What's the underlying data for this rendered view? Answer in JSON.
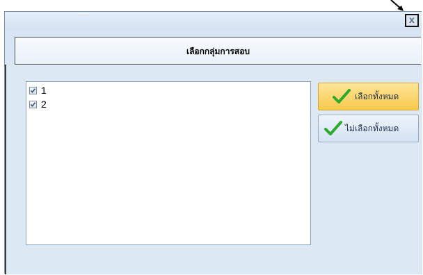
{
  "window": {
    "close_glyph": "x"
  },
  "header": {
    "title": "เลือกกลุ่มการสอบ"
  },
  "list": {
    "items": [
      {
        "label": "1",
        "checked": true
      },
      {
        "label": "2",
        "checked": true
      }
    ]
  },
  "buttons": {
    "select_all": {
      "label": "เลือกทั้งหมด",
      "icon": "check-icon",
      "accent": "#f9c94a"
    },
    "deselect_all": {
      "label": "ไม่เลือกทั้งหมด",
      "icon": "check-icon"
    }
  },
  "colors": {
    "check_green": "#2ea82e",
    "panel_bg": "#dde8f5"
  }
}
